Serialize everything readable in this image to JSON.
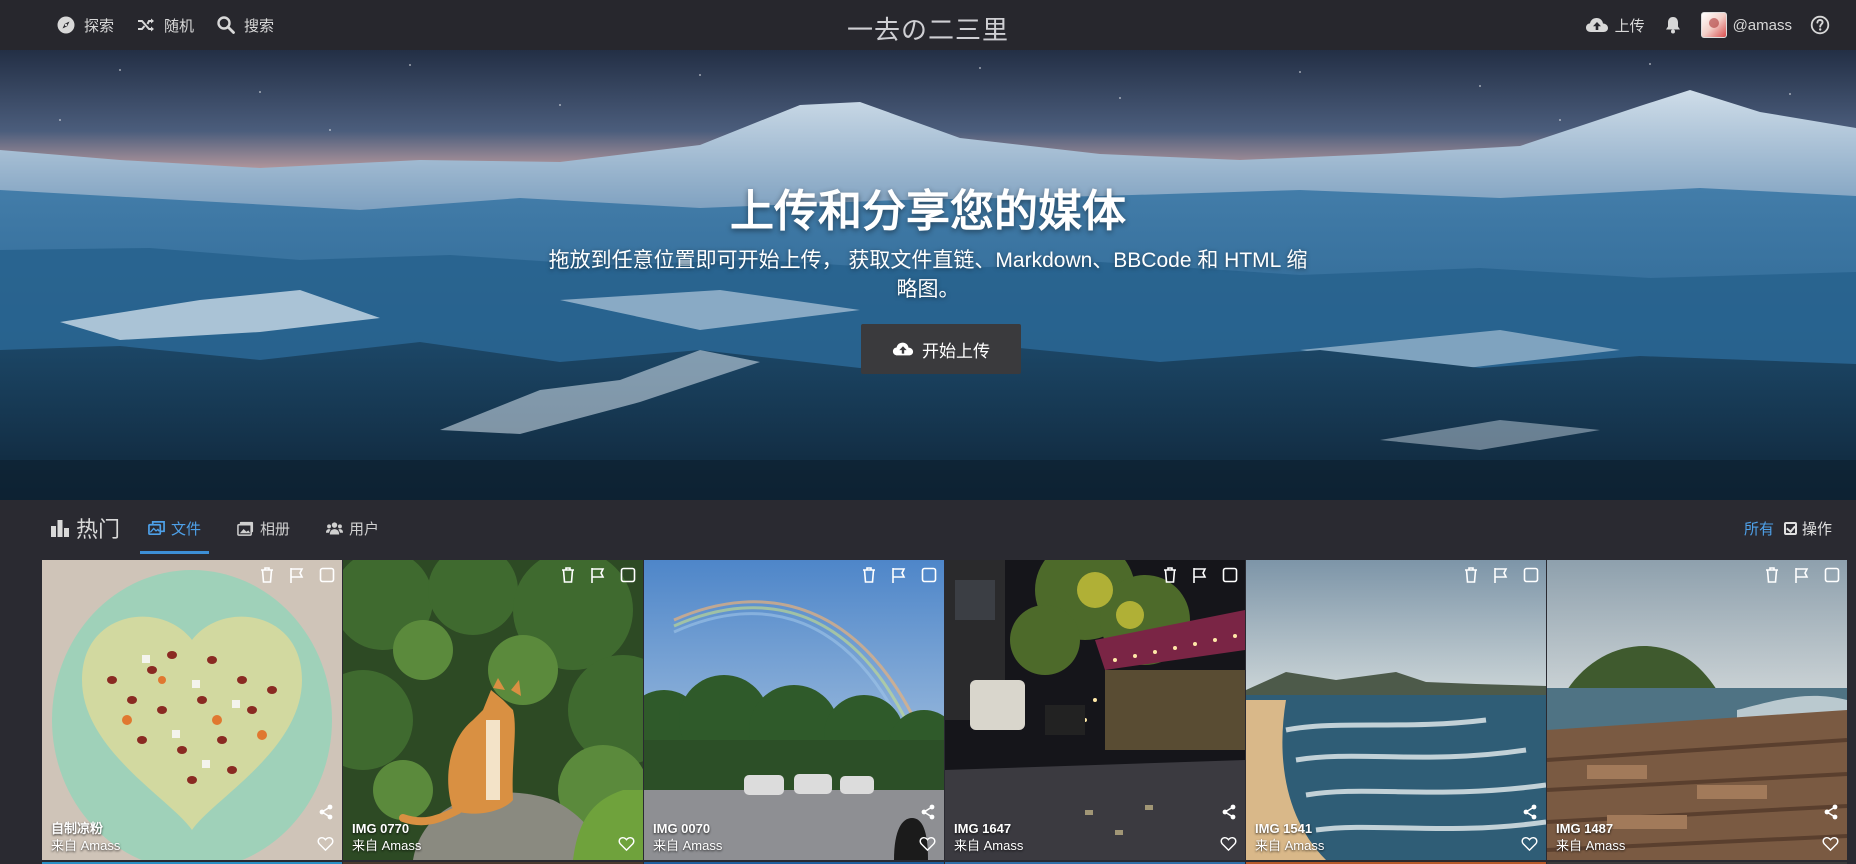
{
  "nav": {
    "explore": "探索",
    "random": "随机",
    "search": "搜索",
    "site_title": "一去の二三里",
    "upload": "上传",
    "username": "@amass"
  },
  "hero": {
    "title": "上传和分享您的媒体",
    "subtitle": "拖放到任意位置即可开始上传， 获取文件直链、Markdown、BBCode 和 HTML 缩略图。",
    "button": "开始上传"
  },
  "listing": {
    "heading": "热门",
    "tabs": [
      {
        "label": "文件",
        "icon": "files-icon",
        "active": true
      },
      {
        "label": "相册",
        "icon": "albums-icon",
        "active": false
      },
      {
        "label": "用户",
        "icon": "users-icon",
        "active": false
      }
    ],
    "filter_all": "所有",
    "actions": "操作"
  },
  "images": [
    {
      "title": "自制凉粉",
      "by": "来自 Amass"
    },
    {
      "title": "IMG 0770",
      "by": "来自 Amass"
    },
    {
      "title": "IMG 0070",
      "by": "来自 Amass"
    },
    {
      "title": "IMG 1647",
      "by": "来自 Amass"
    },
    {
      "title": "IMG 1541",
      "by": "来自 Amass"
    },
    {
      "title": "IMG 1487",
      "by": "来自 Amass"
    }
  ],
  "colors": {
    "accent": "#4ea0e8",
    "topbar": "#27272d",
    "background": "#2a2a31"
  }
}
